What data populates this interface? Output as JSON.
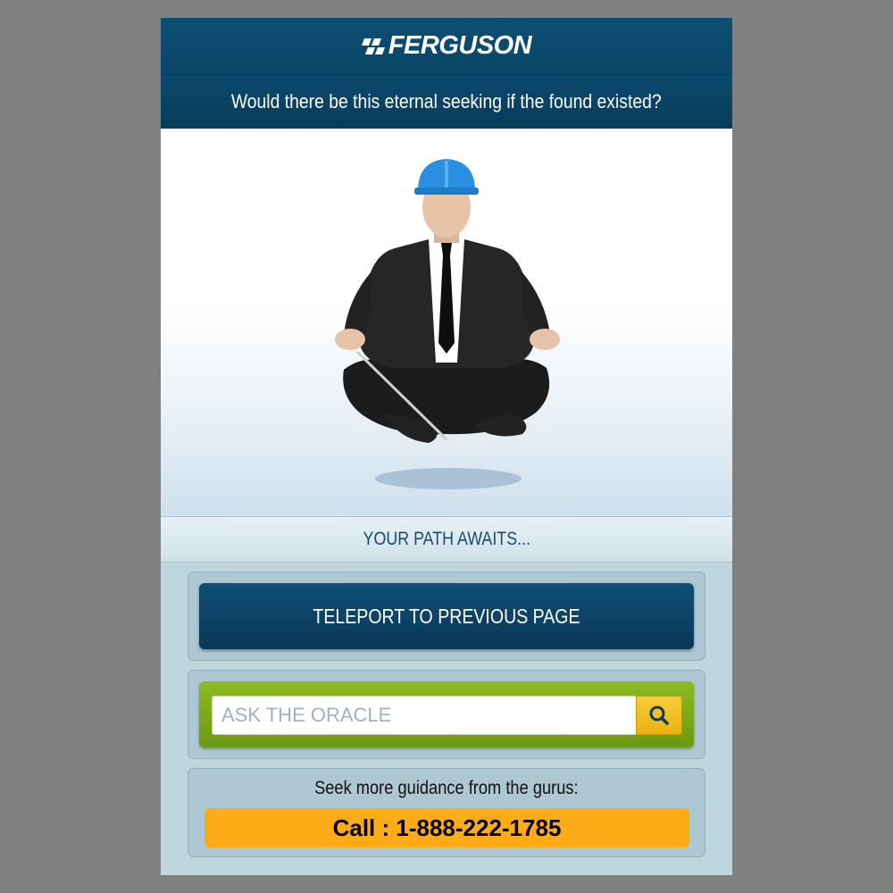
{
  "header": {
    "brand": "FERGUSON",
    "question": "Would there be this eternal seeking if the found existed?"
  },
  "hero": {
    "image": "meditating-businessman-with-hard-hat",
    "hard_hat_color": "#2a8fe0"
  },
  "path": {
    "label": "YOUR PATH AWAITS..."
  },
  "actions": {
    "teleport_label": "TELEPORT TO PREVIOUS PAGE"
  },
  "search": {
    "placeholder": "ASK THE ORACLE",
    "button_icon": "search-icon"
  },
  "contact": {
    "guidance_text": "Seek more guidance from the gurus:",
    "call_label": "Call : 1-888-222-1785"
  },
  "colors": {
    "header_bg": "#0a4567",
    "search_frame": "#7aaa18",
    "search_button": "#f0c126",
    "call_button": "#fdab16",
    "page_bg": "#808080"
  }
}
